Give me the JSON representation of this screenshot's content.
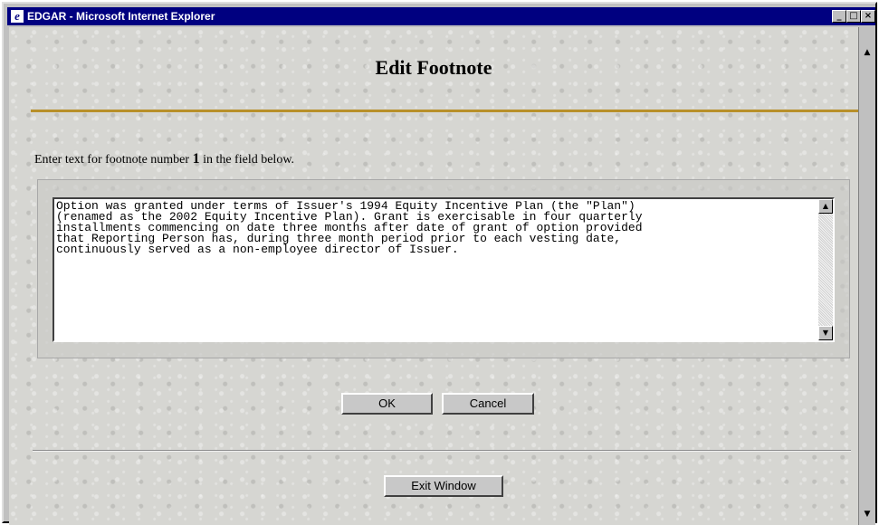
{
  "window": {
    "title": "EDGAR - Microsoft Internet Explorer",
    "icon": "ie-icon",
    "buttons": [
      "minimize",
      "maximize",
      "close"
    ]
  },
  "page": {
    "heading": "Edit Footnote",
    "instruction_prefix": "Enter text for footnote number ",
    "footnote_number": "1",
    "instruction_suffix": " in the field below."
  },
  "footnote": {
    "text": "Option was granted under terms of Issuer's 1994 Equity Incentive Plan (the \"Plan\")\n(renamed as the 2002 Equity Incentive Plan). Grant is exercisable in four quarterly\ninstallments commencing on date three months after date of grant of option provided\nthat Reporting Person has, during three month period prior to each vesting date,\ncontinuously served as a non-employee director of Issuer."
  },
  "buttons": {
    "ok": "OK",
    "cancel": "Cancel",
    "exit": "Exit Window"
  },
  "colors": {
    "title_bar": "#000080",
    "accent_rule": "#b8902a"
  }
}
